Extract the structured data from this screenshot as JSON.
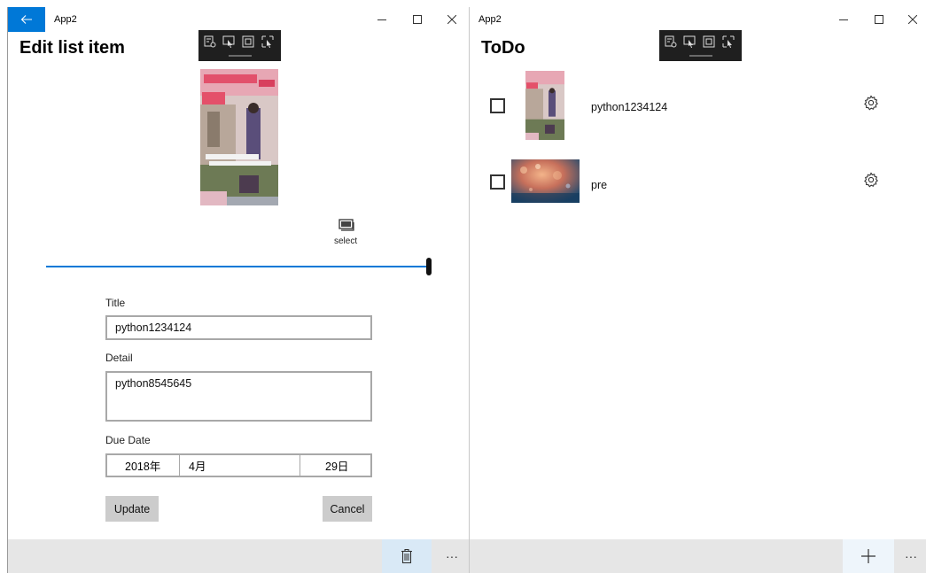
{
  "left_window": {
    "app_title": "App2",
    "page_title": "Edit list item",
    "select_label": "select",
    "slider_fraction": 1.0,
    "form": {
      "title_label": "Title",
      "title_value": "python1234124",
      "detail_label": "Detail",
      "detail_value": "python8545645",
      "due_date_label": "Due Date",
      "date_year": "2018年",
      "date_month": "4月",
      "date_day": "29日",
      "update_label": "Update",
      "cancel_label": "Cancel"
    },
    "more_label": "···"
  },
  "right_window": {
    "app_title": "App2",
    "page_title": "ToDo",
    "items": [
      {
        "text": "python1234124",
        "checked": false
      },
      {
        "text": "pre",
        "checked": false
      }
    ],
    "more_label": "···"
  },
  "colors": {
    "accent": "#0078d7",
    "bottom_bar": "#e6e6e6",
    "button_bg": "#cccccc",
    "debug_toolbar": "#1f1f1f"
  }
}
